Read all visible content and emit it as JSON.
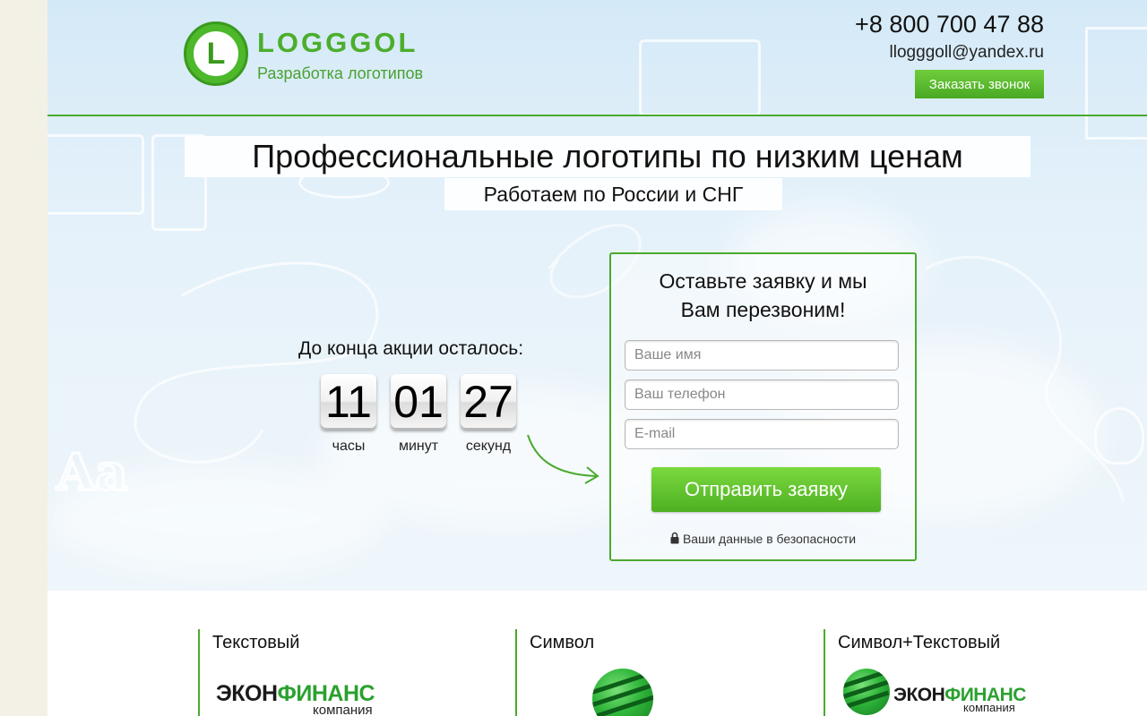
{
  "header": {
    "brand_name": "LOGGGOL",
    "brand_letter": "L",
    "tagline": "Разработка логотипов",
    "phone": "+8 800 700 47 88",
    "email": "llogggoll@yandex.ru",
    "callback_button": "Заказать звонок"
  },
  "hero": {
    "headline": "Профессиональные логотипы по низким ценам",
    "subheadline": "Работаем по России и СНГ"
  },
  "countdown": {
    "label": "До конца акции осталось:",
    "hours": "11",
    "minutes": "01",
    "seconds": "27",
    "hours_label": "часы",
    "minutes_label": "минут",
    "seconds_label": "секунд"
  },
  "form": {
    "title_line1": "Оставьте заявку и мы",
    "title_line2": "Вам перезвоним!",
    "name_placeholder": "Ваше имя",
    "phone_placeholder": "Ваш телефон",
    "email_placeholder": "E-mail",
    "submit_button": "Отправить заявку",
    "security_note": "Ваши данные в безопасности"
  },
  "logo_types": [
    {
      "title": "Текстовый",
      "brand_dark": "ЭКОН",
      "brand_green": "ФИНАНС",
      "brand_sub": "компания"
    },
    {
      "title": "Символ"
    },
    {
      "title": "Символ+Текстовый",
      "brand_dark": "ЭКОН",
      "brand_green": "ФИНАНС",
      "brand_sub": "компания"
    }
  ],
  "colors": {
    "accent_green": "#4aaa2e",
    "button_green": "#5bbf2c",
    "sidebar_bg": "#f3f1e6"
  },
  "icons": {
    "lock": "lock-icon",
    "arrow": "curved-arrow-icon"
  }
}
